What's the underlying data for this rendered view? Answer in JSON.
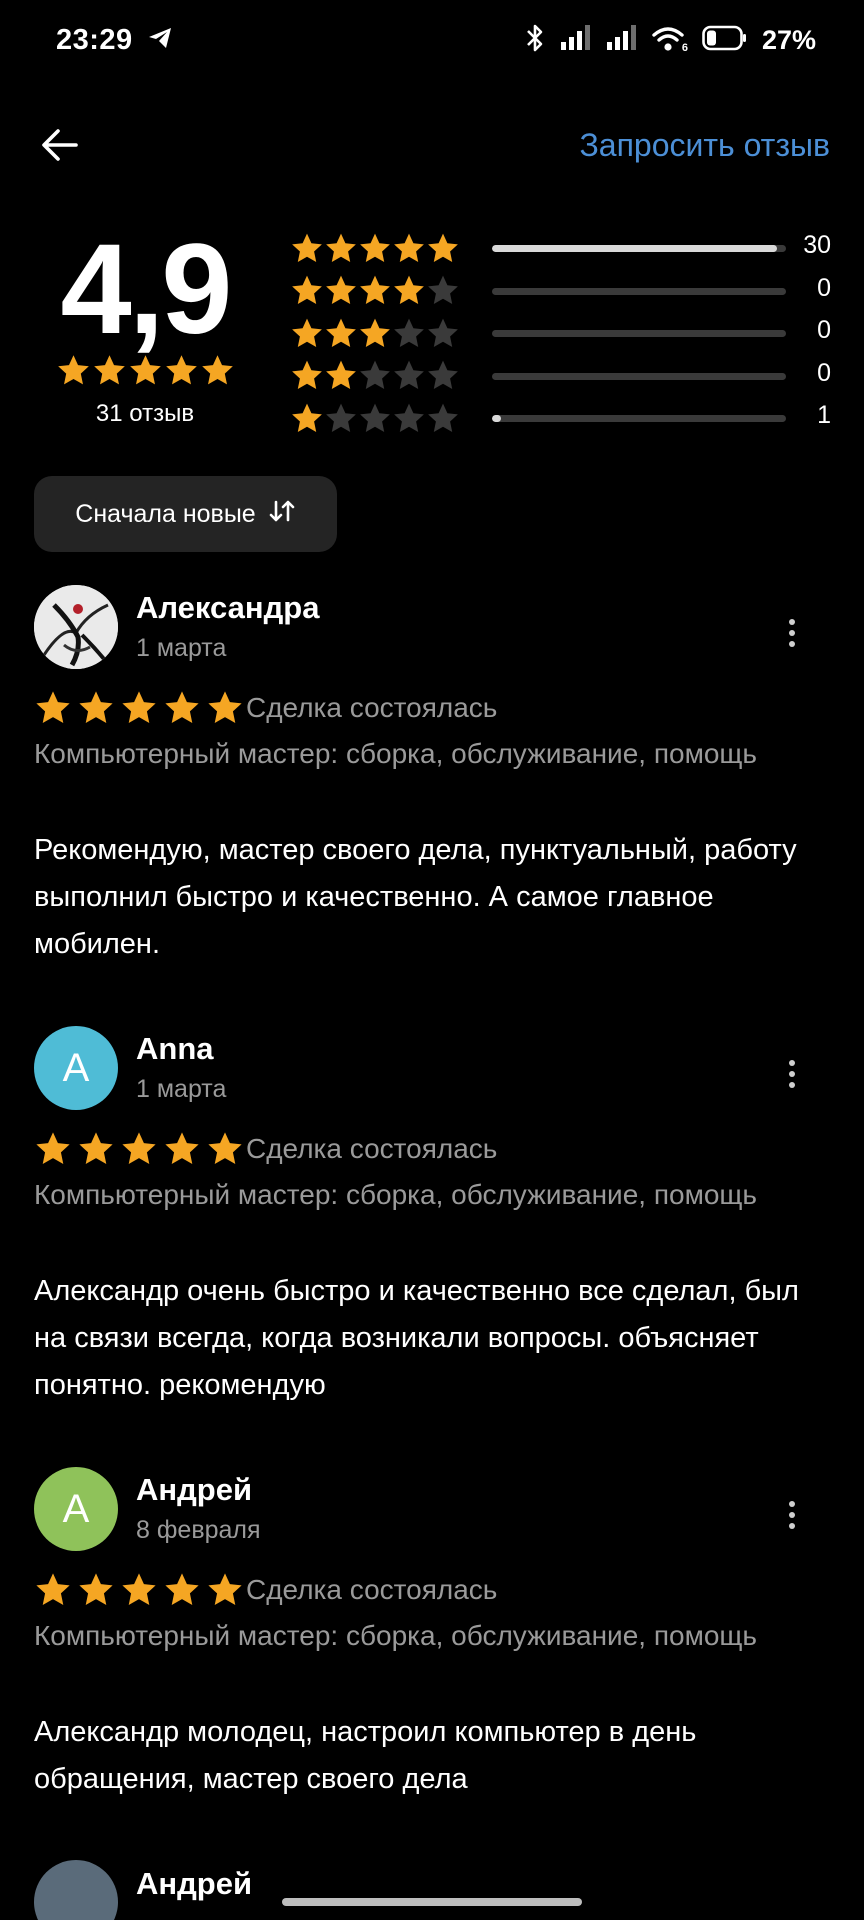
{
  "status_bar": {
    "time": "23:29",
    "battery": "27%",
    "wifi_badge": "6"
  },
  "top_bar": {
    "request_review_label": "Запросить отзыв",
    "accent_color": "#4c8fd6"
  },
  "summary": {
    "rating": "4,9",
    "rating_stars": 5,
    "review_count": "31 отзыв",
    "distribution": [
      {
        "stars": 5,
        "count": "30",
        "fraction": 0.97
      },
      {
        "stars": 4,
        "count": "0",
        "fraction": 0
      },
      {
        "stars": 3,
        "count": "0",
        "fraction": 0
      },
      {
        "stars": 2,
        "count": "0",
        "fraction": 0
      },
      {
        "stars": 1,
        "count": "1",
        "fraction": 0.03
      }
    ]
  },
  "sort": {
    "label": "Сначала новые"
  },
  "colors": {
    "star": "#f5a623",
    "star_empty": "#3a3a3a",
    "avatar_anna": "#4fbcd6",
    "avatar_andrey": "#8fc25a"
  },
  "reviews": [
    {
      "author": "Александра",
      "date": "1 марта",
      "rating": 5,
      "status": "Сделка состоялась",
      "category": "Компьютерный мастер: сборка, обслуживание, помощь",
      "text": "Рекомендую, мастер своего дела, пунктуальный, работу выполнил быстро и качественно. А самое главное мобилен.",
      "avatar_letter": ""
    },
    {
      "author": "Anna",
      "date": "1 марта",
      "rating": 5,
      "status": "Сделка состоялась",
      "category": "Компьютерный мастер: сборка, обслуживание, помощь",
      "text": "Александр очень быстро и качественно все сделал, был на связи всегда, когда возникали вопросы. объясняет понятно. рекомендую",
      "avatar_letter": "A"
    },
    {
      "author": "Андрей",
      "date": "8 февраля",
      "rating": 5,
      "status": "Сделка состоялась",
      "category": "Компьютерный мастер: сборка, обслуживание, помощь",
      "text": "Александр молодец, настроил компьютер в день обращения, мастер своего дела",
      "avatar_letter": "A"
    },
    {
      "author": "Андрей"
    }
  ]
}
